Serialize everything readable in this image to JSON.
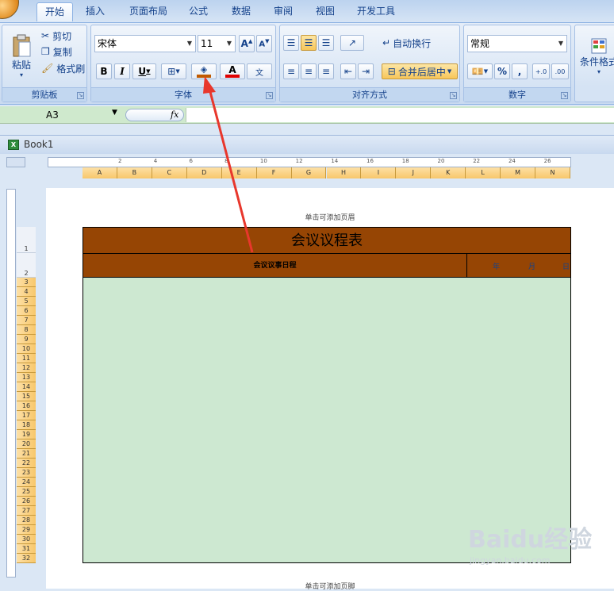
{
  "tabs": [
    "开始",
    "插入",
    "页面布局",
    "公式",
    "数据",
    "审阅",
    "视图",
    "开发工具"
  ],
  "clipboard": {
    "paste": "粘贴",
    "cut": "剪切",
    "copy": "复制",
    "format_painter": "格式刷",
    "label": "剪贴板"
  },
  "font": {
    "name": "宋体",
    "size": "11",
    "bold": "B",
    "italic": "I",
    "underline": "U",
    "label": "字体"
  },
  "alignment": {
    "wrap": "自动换行",
    "merge": "合并后居中",
    "label": "对齐方式"
  },
  "number": {
    "format": "常规",
    "percent": "%",
    "comma": ",",
    "label": "数字",
    "inc_decimal": "+.0",
    "dec_decimal": ".00"
  },
  "styles": {
    "conditional": "条件格式"
  },
  "formula_bar": {
    "cell_ref": "A3",
    "fx": "fx"
  },
  "workbook": {
    "title": "Book1"
  },
  "columns": [
    "A",
    "B",
    "C",
    "D",
    "E",
    "F",
    "G",
    "H",
    "I",
    "J",
    "K",
    "L",
    "M",
    "N"
  ],
  "ruler_numbers": [
    "2",
    "4",
    "6",
    "8",
    "10",
    "12",
    "14",
    "16",
    "18",
    "20",
    "22",
    "24",
    "26"
  ],
  "rows": [
    "1",
    "2",
    "3",
    "4",
    "5",
    "6",
    "7",
    "8",
    "9",
    "10",
    "11",
    "12",
    "13",
    "14",
    "15",
    "16",
    "17",
    "18",
    "19",
    "20",
    "21",
    "22",
    "23",
    "24",
    "25",
    "26",
    "27",
    "28",
    "29",
    "30",
    "31",
    "32"
  ],
  "page": {
    "header_hint": "单击可添加页眉",
    "footer_hint": "单击可添加页脚",
    "title": "会议议程表",
    "subtitle": "会议议事日程",
    "year": "年",
    "month": "月",
    "day": "日"
  },
  "colors": {
    "title_fill": "#964504",
    "body_fill": "#cde8d1",
    "arrow": "#e8372c",
    "fill_swatch": "#c05a00",
    "font_swatch": "#e00000"
  },
  "watermark": {
    "brand": "Baidu经验",
    "url": "jingyan.baidu.com"
  }
}
